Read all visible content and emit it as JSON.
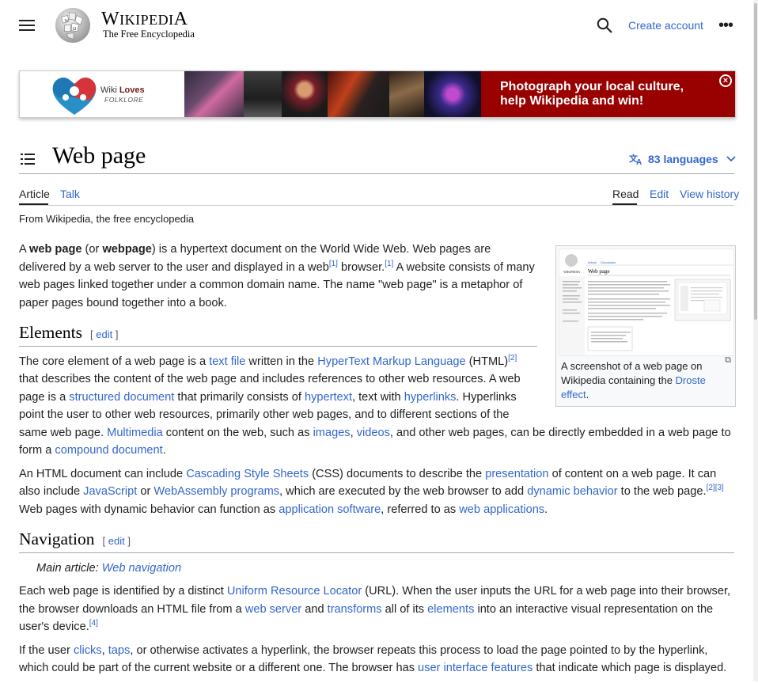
{
  "header": {
    "wordmark_first": "W",
    "wordmark_rest": "IKIPEDI",
    "wordmark_last": "A",
    "tagline": "The Free Encyclopedia",
    "create_account": "Create account",
    "more": "•••"
  },
  "banner": {
    "logo_line1_a": "Wiki ",
    "logo_line1_b": "Loves",
    "logo_line2": "FOLKLORE",
    "cta": "Photograph your local culture, help Wikipedia and win!",
    "close": "×",
    "accent": "#990000"
  },
  "page": {
    "title": "Web page",
    "languages": "83 languages",
    "tabs_left": [
      "Article",
      "Talk"
    ],
    "tabs_right": [
      "Read",
      "Edit",
      "View history"
    ],
    "from": "From Wikipedia, the free encyclopedia"
  },
  "thumb": {
    "caption_a": "A screenshot of a web page on Wikipedia containing the ",
    "caption_link": "Droste effect",
    "caption_end": ".",
    "mini_wordmark": "WIKIPEDIA",
    "mini_title": "Web page",
    "mini_tabs": [
      "Article",
      "Discussion"
    ]
  },
  "intro": {
    "t1": "A ",
    "b1": "web page",
    "t2": " (or ",
    "b2": "webpage",
    "t3": ") is a hypertext document on the World Wide Web. Web pages are delivered by a web server to the user and displayed in a web",
    "r1": "[1]",
    "t4": " browser.",
    "r2": "[1]",
    "t5": " A website consists of many web pages linked together under a common domain name. The name \"web page\" is a metaphor of paper pages bound together into a book."
  },
  "elements": {
    "heading": "Elements",
    "edit": "[ edit ]",
    "p1": [
      "The core element of a web page is a ",
      "text file",
      " written in the ",
      "HyperText Markup Language",
      " (HTML)",
      "[2]",
      " that describes the content of the web page and includes references to other web resources. A web page is a ",
      "structured document",
      " that primarily consists of ",
      "hypertext",
      ", text with ",
      "hyperlinks",
      ". Hyperlinks point the user to other web resources, primarily other web pages, and to different sections of the same web page. ",
      "Multimedia",
      " content on the web, such as ",
      "images",
      ", ",
      "videos",
      ", and other web pages, can be directly embedded in a web page to form a ",
      "compound document",
      "."
    ],
    "p2": [
      "An HTML document can include ",
      "Cascading Style Sheets",
      " (CSS) documents to describe the ",
      "presentation",
      " of content on a web page. It can also include ",
      "JavaScript",
      " or ",
      "WebAssembly programs",
      ", which are executed by the web browser to add ",
      "dynamic behavior",
      " to the web page.",
      "[2]",
      "[3]",
      " Web pages with dynamic behavior can function as ",
      "application software",
      ", referred to as ",
      "web applications",
      "."
    ]
  },
  "navigation": {
    "heading": "Navigation",
    "edit": "[ edit ]",
    "hatnote_label": "Main article: ",
    "hatnote_link": "Web navigation",
    "p1": [
      "Each web page is identified by a distinct ",
      "Uniform Resource Locator",
      " (URL). When the user inputs the URL for a web page into their browser, the browser downloads an HTML file from a ",
      "web server",
      " and ",
      "transforms",
      " all of its ",
      "elements",
      " into an interactive visual representation on the user's device.",
      "[4]"
    ],
    "p2": [
      "If the user ",
      "clicks",
      ", ",
      "taps",
      ", or otherwise activates a hyperlink, the browser repeats this process to load the page pointed to by the hyperlink, which could be part of the current website or a different one. The browser has ",
      "user interface features",
      " that indicate which page is displayed."
    ]
  }
}
